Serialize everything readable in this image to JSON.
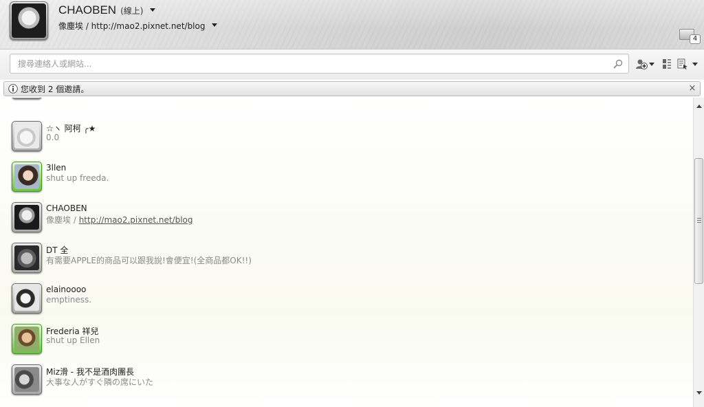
{
  "profile": {
    "name": "CHAOBEN",
    "status": "(線上)",
    "message": "像塵埃 / http://mao2.pixnet.net/blog"
  },
  "tray": {
    "count": "4",
    "icon": "inbox-tray-icon"
  },
  "search": {
    "placeholder": "搜尋連絡人或網站..."
  },
  "notice": {
    "text": "您收到 2 個邀請。",
    "close": "×"
  },
  "contacts": [
    {
      "name": "☆ヽ 阿柯 ╭★",
      "message": "0.0",
      "online": false
    },
    {
      "name": "3llen",
      "message": "shut up freeda.",
      "online": true
    },
    {
      "name": "CHAOBEN",
      "message_prefix": "像塵埃 / ",
      "message_link": "http://mao2.pixnet.net/blog",
      "online": false
    },
    {
      "name": "DT 全",
      "message": "有需要APPLE的商品可以跟我說!會便宜!(全商品都OK!!)",
      "online": false
    },
    {
      "name": "elainoooo",
      "message": "emptiness.",
      "online": false
    },
    {
      "name": "Frederia 祥兒",
      "message": "shut up Ellen",
      "online": true
    },
    {
      "name": "Miz滑 - 我不是酒肉團長",
      "message": "大事な人がすぐ隣の席にいた",
      "online": false
    }
  ],
  "colors": {
    "online_frame": "#66c33a",
    "offline_frame": "#a8a8a8",
    "message_text": "#8a8a8a"
  }
}
